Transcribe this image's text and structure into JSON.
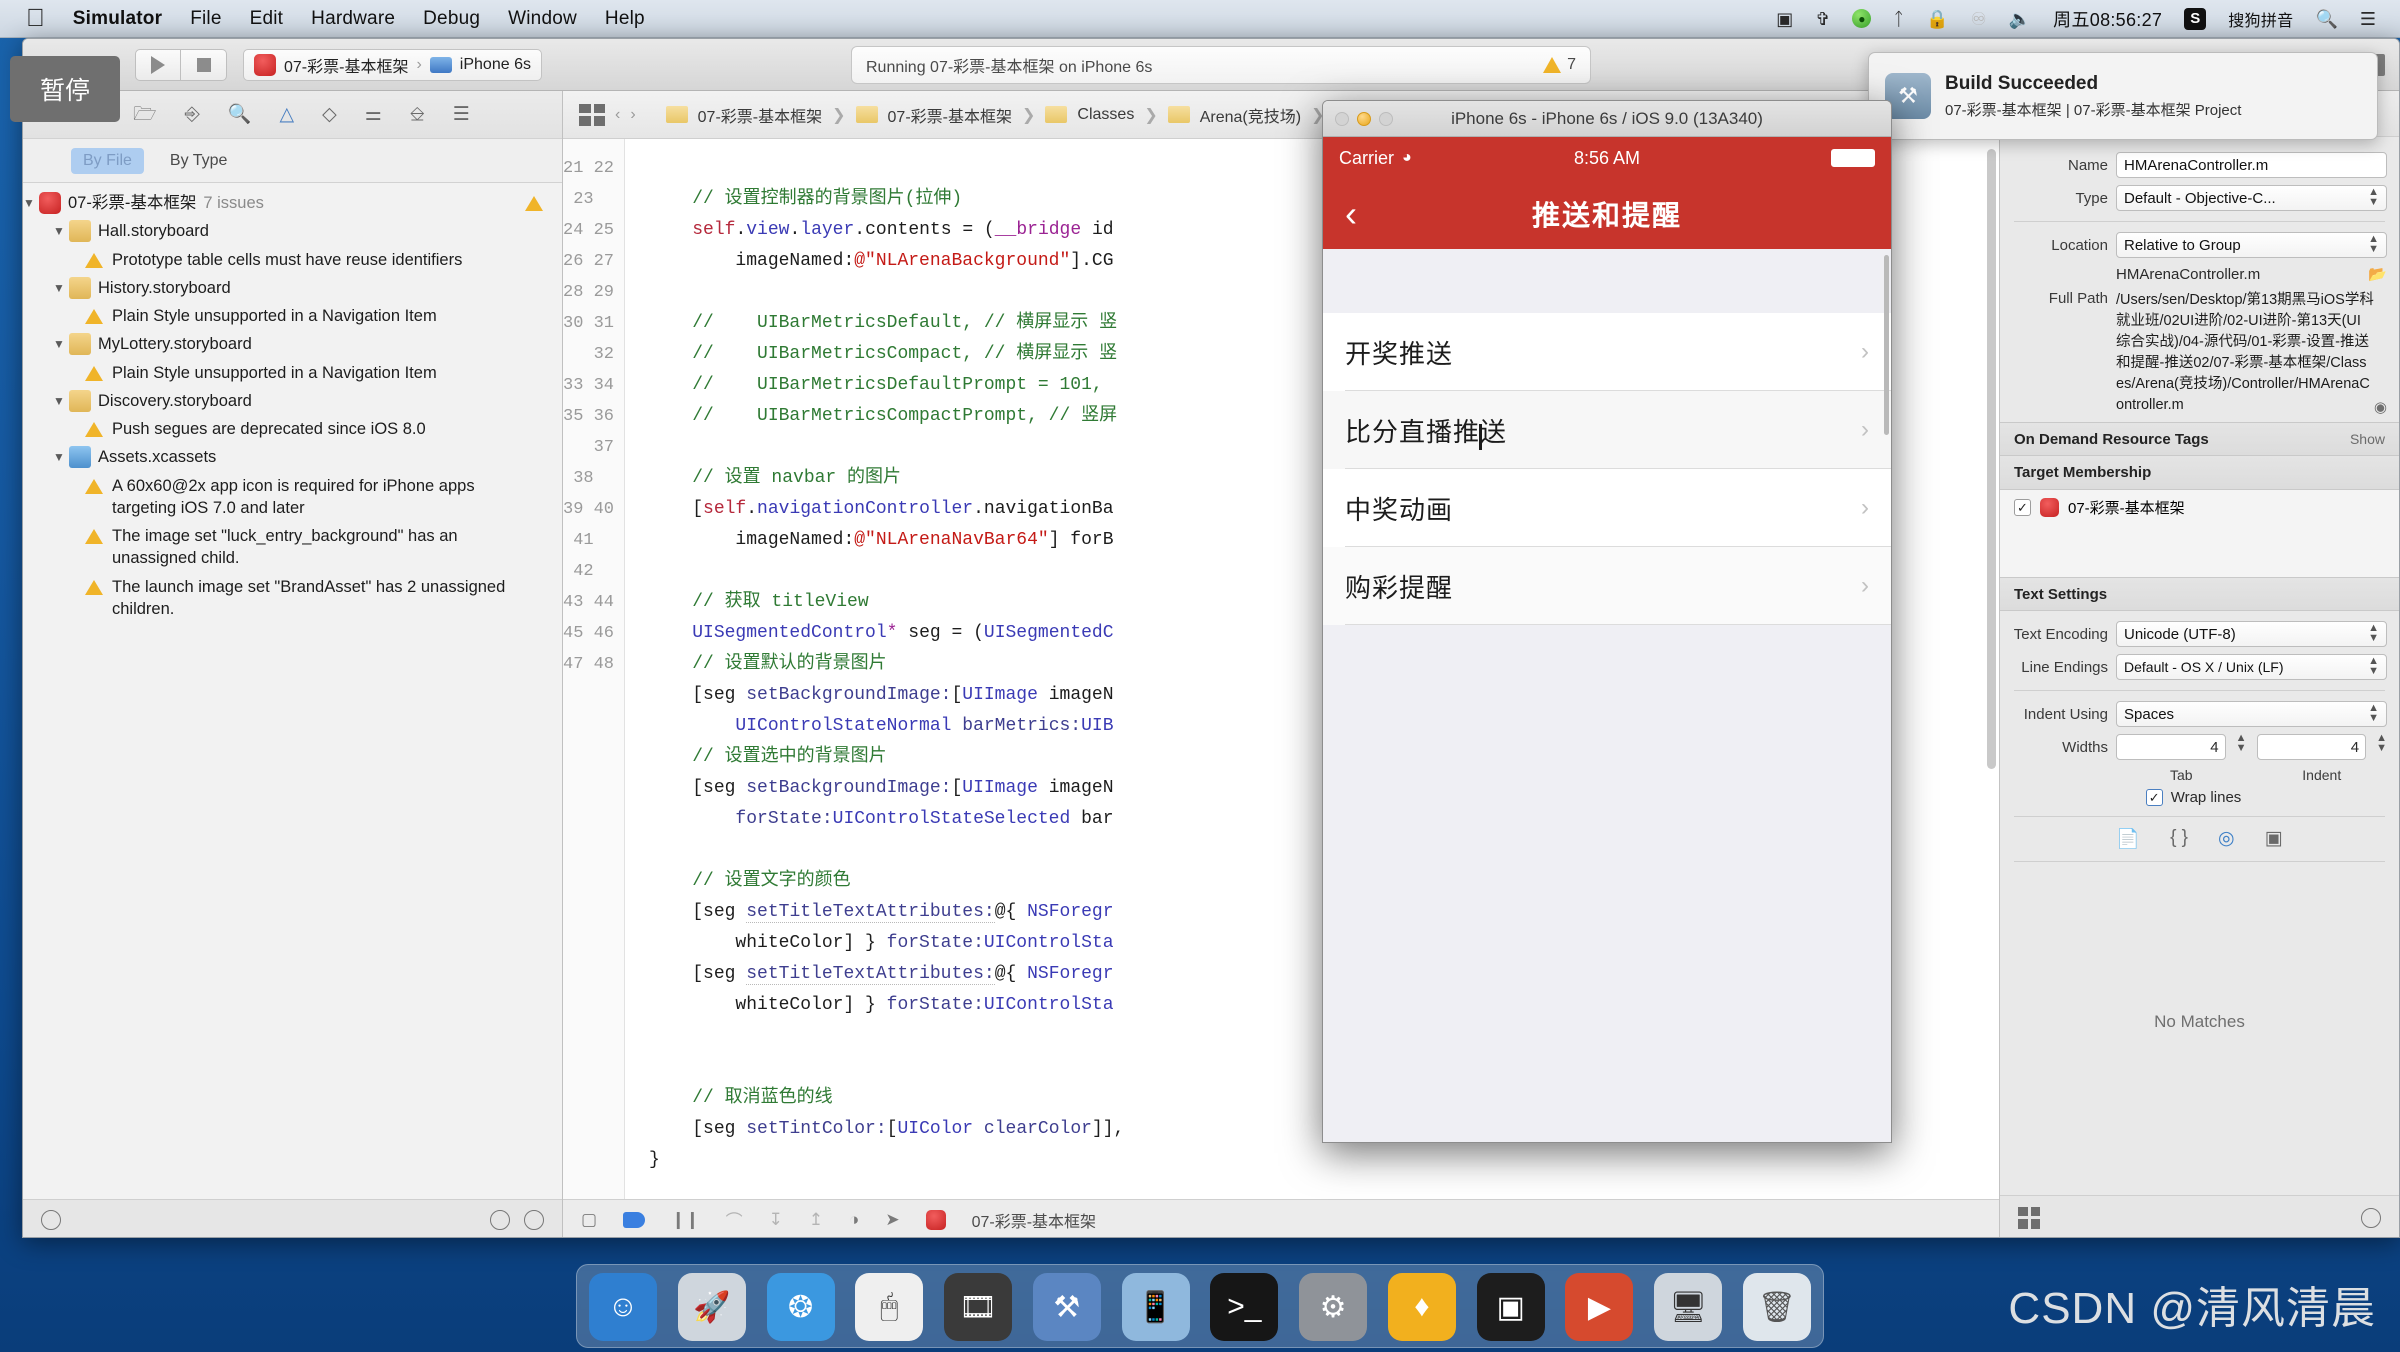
{
  "menubar": {
    "apple": "",
    "items": [
      "Simulator",
      "File",
      "Edit",
      "Hardware",
      "Debug",
      "Window",
      "Help"
    ],
    "right": {
      "screen_record_icon": "screen-record-icon",
      "airdrop_icon": "airdrop-icon",
      "dropbox_icon": "dropbox-icon",
      "bluetooth_icon": "bluetooth-icon",
      "lock_icon": "lock-icon",
      "shield_icon": "shield-icon",
      "volume_icon": "volume-icon",
      "time": "周五08:56:27",
      "ime_badge": "S",
      "ime_label": "搜狗拼音",
      "search_icon": "search-icon",
      "notification_icon": "notification-center-icon"
    }
  },
  "tooltip": {
    "text": "暂停"
  },
  "toolbar": {
    "run_icon": "run-icon",
    "stop_icon": "stop-icon",
    "scheme": "07-彩票-基本框架",
    "scheme_sep": "›",
    "destination": "iPhone 6s",
    "status": "Running 07-彩票-基本框架 on iPhone 6s",
    "warning_count": "7"
  },
  "build_popup": {
    "icon": "xcode-hammer-icon",
    "title": "Build Succeeded",
    "subtitle": "07-彩票-基本框架 | 07-彩票-基本框架 Project"
  },
  "navigator": {
    "toolbar_icons": [
      "folder-icon",
      "source-control-icon",
      "search-icon",
      "warning-triangle-icon",
      "debug-diamond-icon",
      "breakpoint-icon",
      "tag-icon",
      "report-icon"
    ],
    "filter": {
      "by_file": "By File",
      "by_type": "By Type"
    },
    "project": {
      "name": "07-彩票-基本框架",
      "issue_count": "7 issues"
    },
    "groups": [
      {
        "file": "Hall.storyboard",
        "icon": "storyboard-icon",
        "issues": [
          "Prototype table cells must have reuse identifiers"
        ]
      },
      {
        "file": "History.storyboard",
        "icon": "storyboard-icon",
        "issues": [
          "Plain Style unsupported in a Navigation Item"
        ]
      },
      {
        "file": "MyLottery.storyboard",
        "icon": "storyboard-icon",
        "issues": [
          "Plain Style unsupported in a Navigation Item"
        ]
      },
      {
        "file": "Discovery.storyboard",
        "icon": "storyboard-icon",
        "issues": [
          "Push segues are deprecated since iOS 8.0"
        ]
      },
      {
        "file": "Assets.xcassets",
        "icon": "assets-icon",
        "issues": [
          "A 60x60@2x app icon is required for iPhone apps targeting iOS 7.0 and later",
          "The image set \"luck_entry_background\" has an unassigned child.",
          "The launch image set \"BrandAsset\" has 2 unassigned children."
        ]
      }
    ],
    "bottom_icons": [
      "add-icon",
      "filter-icon",
      "recent-icon"
    ]
  },
  "editor": {
    "breadcrumb": [
      "07-彩票-基本框架",
      "07-彩票-基本框架",
      "Classes",
      "Arena(竞技场)"
    ],
    "jump_icon": "related-items-icon",
    "back_icon": "chevron-left-icon",
    "forward_icon": "chevron-right-icon",
    "first_line": 21,
    "lines": [
      {
        "n": 21,
        "text": ""
      },
      {
        "n": 22,
        "text": "    // 设置控制器的背景图片(拉伸)"
      },
      {
        "n": 23,
        "text": "    self.view.layer.contents = (__bridge id"
      },
      {
        "n": "",
        "text": "        imageNamed:@\"NLArenaBackground\"].CG"
      },
      {
        "n": 24,
        "text": ""
      },
      {
        "n": 25,
        "text": "    //    UIBarMetricsDefault, // 横屏显示 竖"
      },
      {
        "n": 26,
        "text": "    //    UIBarMetricsCompact, // 横屏显示 竖"
      },
      {
        "n": 27,
        "text": "    //    UIBarMetricsDefaultPrompt = 101,"
      },
      {
        "n": 28,
        "text": "    //    UIBarMetricsCompactPrompt, // 竖屏"
      },
      {
        "n": 29,
        "text": ""
      },
      {
        "n": 30,
        "text": "    // 设置 navbar 的图片"
      },
      {
        "n": 31,
        "text": "    [self.navigationController.navigationBa"
      },
      {
        "n": "",
        "text": "        imageNamed:@\"NLArenaNavBar64\"] forB"
      },
      {
        "n": 32,
        "text": ""
      },
      {
        "n": 33,
        "text": "    // 获取 titleView"
      },
      {
        "n": 34,
        "text": "    UISegmentedControl* seg = (UISegmentedC                        iew;"
      },
      {
        "n": 35,
        "text": "    // 设置默认的背景图片"
      },
      {
        "n": 36,
        "text": "    [seg setBackgroundImage:[UIImage imageN"
      },
      {
        "n": "",
        "text": "        UIControlStateNormal barMetrics:UIB"
      },
      {
        "n": 37,
        "text": "    // 设置选中的背景图片"
      },
      {
        "n": 38,
        "text": "    [seg setBackgroundImage:[UIImage imageN"
      },
      {
        "n": "",
        "text": "        forState:UIControlStateSelected bar"
      },
      {
        "n": 39,
        "text": ""
      },
      {
        "n": 40,
        "text": "    // 设置文字的颜色"
      },
      {
        "n": 41,
        "text": "    [seg setTitleTextAttributes:@{ NSForegr"
      },
      {
        "n": "",
        "text": "        whiteColor] } forState:UIControlSta"
      },
      {
        "n": 42,
        "text": "    [seg setTitleTextAttributes:@{ NSForegr"
      },
      {
        "n": "",
        "text": "        whiteColor] } forState:UIControlSta"
      },
      {
        "n": 43,
        "text": ""
      },
      {
        "n": 44,
        "text": ""
      },
      {
        "n": 45,
        "text": "    // 取消蓝色的线"
      },
      {
        "n": 46,
        "text": "    [seg setTintColor:[UIColor clearColor]],"
      },
      {
        "n": 47,
        "text": "}"
      },
      {
        "n": 48,
        "text": ""
      }
    ],
    "bottom_bar": {
      "icons": [
        "breakpoint-toggle-icon",
        "continue-icon",
        "pause-icon",
        "step-over-icon",
        "step-into-icon",
        "step-out-icon",
        "view-debug-icon",
        "location-icon"
      ],
      "process": "07-彩票-基本框架"
    }
  },
  "inspector": {
    "tabs": [
      "file-inspector-icon",
      "quick-help-icon",
      "identity-icon",
      "attributes-icon",
      "size-icon",
      "connections-icon"
    ],
    "identity_and_type": {
      "name_label": "Name",
      "name_value": "HMArenaController.m",
      "type_label": "Type",
      "type_value": "Default - Objective-C...",
      "location_label": "Location",
      "location_value": "Relative to Group",
      "file_value": "HMArenaController.m",
      "full_path_label": "Full Path",
      "full_path_value": "/Users/sen/Desktop/第13期黑马iOS学科就业班/02UI进阶/02-UI进阶-第13天(UI综合实战)/04-源代码/01-彩票-设置-推送和提醒-推送02/07-彩票-基本框架/Classes/Arena(竞技场)/Controller/HMArenaController.m"
    },
    "on_demand": {
      "title": "On Demand Resource Tags",
      "show": "Show"
    },
    "target_membership": {
      "title": "Target Membership",
      "target": "07-彩票-基本框架",
      "checked": "✓"
    },
    "text_settings": {
      "title": "Text Settings",
      "encoding_label": "Text Encoding",
      "encoding_value": "Unicode (UTF-8)",
      "line_endings_label": "Line Endings",
      "line_endings_value": "Default - OS X / Unix (LF)",
      "indent_label": "Indent Using",
      "indent_value": "Spaces",
      "widths_label": "Widths",
      "tab_width": "4",
      "indent_width": "4",
      "tab_caption": "Tab",
      "indent_caption": "Indent",
      "wrap_lines_label": "Wrap lines",
      "wrap_checked": "✓"
    },
    "quick_help": {
      "no_matches": "No Matches"
    },
    "bottom_icons": [
      "library-file-icon",
      "code-snippet-icon",
      "object-library-icon",
      "media-library-icon"
    ]
  },
  "simulator": {
    "window_title": "iPhone 6s - iPhone 6s / iOS 9.0 (13A340)",
    "status": {
      "carrier": "Carrier",
      "wifi_icon": "wifi-icon",
      "time": "8:56 AM",
      "battery_icon": "battery-icon"
    },
    "navbar": {
      "back_icon": "chevron-left-icon",
      "title": "推送和提醒"
    },
    "cells": [
      {
        "label": "开奖推送",
        "accessory": "chevron-right-icon"
      },
      {
        "label": "比分直播推送",
        "accessory": "chevron-right-icon"
      },
      {
        "label": "中奖动画",
        "accessory": "chevron-right-icon"
      },
      {
        "label": "购彩提醒",
        "accessory": "chevron-right-icon"
      }
    ]
  },
  "dock": {
    "items": [
      {
        "name": "finder-icon",
        "glyph": "☺",
        "color": "#2f7fd0"
      },
      {
        "name": "launchpad-icon",
        "glyph": "◐",
        "color": "#cfd6dd"
      },
      {
        "name": "safari-icon",
        "glyph": "❂",
        "color": "#3b98e0"
      },
      {
        "name": "mouse-icon",
        "glyph": "❖",
        "color": "#efefef"
      },
      {
        "name": "quicktime-icon",
        "glyph": "▶",
        "color": "#3a3a3a"
      },
      {
        "name": "xcode-icon",
        "glyph": "⚒",
        "color": "#5b86c2"
      },
      {
        "name": "simulator-icon",
        "glyph": "▭",
        "color": "#8fb8dd"
      },
      {
        "name": "terminal-icon",
        "glyph": "⌫",
        "color": "#161616"
      },
      {
        "name": "settings-icon",
        "glyph": "⚙",
        "color": "#8f9399"
      },
      {
        "name": "sketch-icon",
        "glyph": "◆",
        "color": "#f2b01e"
      },
      {
        "name": "mac-icon",
        "glyph": "▣",
        "color": "#1d1d1d"
      },
      {
        "name": "media-icon",
        "glyph": "●",
        "color": "#d64a2e"
      },
      {
        "name": "screens-icon",
        "glyph": "▤",
        "color": "#cfd6dd"
      },
      {
        "name": "trash-icon",
        "glyph": "♨",
        "color": "#dfe6ec"
      }
    ]
  },
  "watermark": {
    "text": "CSDN @清风清晨"
  }
}
